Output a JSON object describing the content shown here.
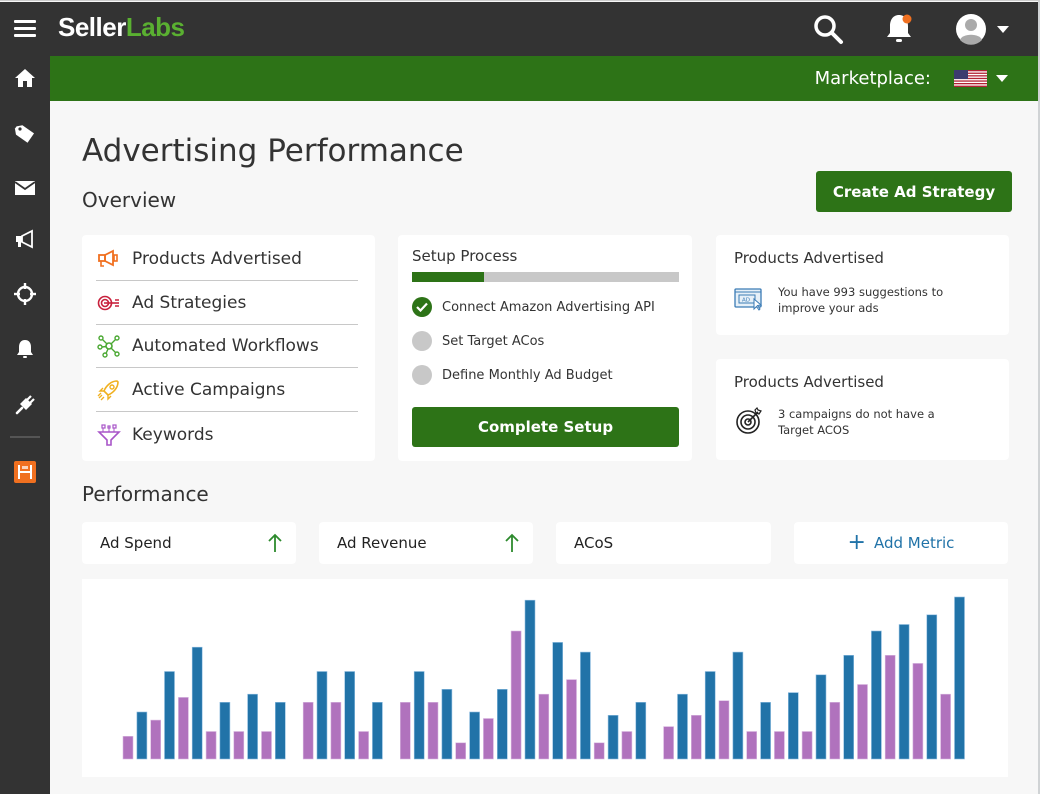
{
  "app": {
    "logo_part1": "Seller",
    "logo_part2": "Labs",
    "colors": {
      "brand_green": "#2d7317",
      "logo_green": "#5ab031",
      "dark": "#333333",
      "notification": "#f07020",
      "bar_purple": "#b072bd",
      "bar_blue": "#2173a8",
      "link_blue": "#2173a8"
    }
  },
  "topbar": {
    "menu_icon": "hamburger-icon",
    "search_icon": "search-icon",
    "notification_icon": "bell-icon",
    "avatar_icon": "user-avatar-icon",
    "has_notification": true
  },
  "marketplace": {
    "label": "Marketplace:",
    "selected": "United States",
    "flag_icon": "us-flag-icon"
  },
  "sidebar": {
    "items": [
      {
        "name": "home",
        "icon": "home-icon"
      },
      {
        "name": "products",
        "icon": "tag-icon"
      },
      {
        "name": "messages",
        "icon": "envelope-icon"
      },
      {
        "name": "advertising",
        "icon": "megaphone-icon"
      },
      {
        "name": "targeting",
        "icon": "crosshair-icon"
      },
      {
        "name": "notifications",
        "icon": "bell-icon"
      },
      {
        "name": "integrations",
        "icon": "plug-icon"
      },
      {
        "name": "app",
        "icon": "app-logo-icon"
      }
    ]
  },
  "page": {
    "title": "Advertising Performance",
    "overview_heading": "Overview",
    "create_button": "Create Ad Strategy",
    "performance_heading": "Performance"
  },
  "overview_nav": [
    {
      "label": "Products Advertised",
      "icon": "megaphone-icon",
      "color": "#f07020"
    },
    {
      "label": "Ad Strategies",
      "icon": "target-arrow-icon",
      "color": "#c8203c"
    },
    {
      "label": "Automated Workflows",
      "icon": "network-icon",
      "color": "#4aa832"
    },
    {
      "label": "Active Campaigns",
      "icon": "rocket-icon",
      "color": "#f0b020"
    },
    {
      "label": "Keywords",
      "icon": "funnel-icon",
      "color": "#a855c8"
    }
  ],
  "setup": {
    "title": "Setup Process",
    "progress_percent": 27,
    "steps": [
      {
        "label": "Connect Amazon Advertising API",
        "done": true
      },
      {
        "label": "Set Target ACos",
        "done": false
      },
      {
        "label": "Define Monthly Ad Budget",
        "done": false
      }
    ],
    "button": "Complete Setup"
  },
  "suggestions": [
    {
      "title": "Products Advertised",
      "text_line1": "You have 993 suggestions to",
      "text_line2": "improve your ads",
      "icon": "ad-click-icon"
    },
    {
      "title": "Products Advertised",
      "text_line1": "3 campaigns do not have a",
      "text_line2": "Target ACOS",
      "icon": "target-icon"
    }
  ],
  "metrics": [
    {
      "label": "Ad Spend",
      "trend": "up"
    },
    {
      "label": "Ad Revenue",
      "trend": "up"
    },
    {
      "label": "ACoS",
      "trend": null
    }
  ],
  "add_metric": {
    "label": "Add Metric"
  },
  "chart_data": {
    "type": "bar",
    "title": "",
    "xlabel": "",
    "ylabel": "",
    "ylim": [
      0,
      100
    ],
    "grid": false,
    "legend": "none",
    "series_names": [
      "purple",
      "blue"
    ],
    "groups": [
      {
        "purple": [
          14,
          24,
          38,
          17,
          17,
          17
        ],
        "blue": [
          29,
          54,
          69,
          35,
          40,
          35
        ]
      },
      {
        "purple": [
          35,
          35,
          17
        ],
        "blue": [
          54,
          54,
          35
        ]
      },
      {
        "purple": [
          35,
          35,
          10,
          25,
          79,
          40,
          49,
          10,
          17
        ],
        "blue": [
          54,
          43,
          29,
          43,
          98,
          72,
          66,
          27,
          35
        ]
      },
      {
        "purple": [
          20,
          27,
          36,
          17,
          17,
          17,
          35,
          46,
          64,
          59,
          40
        ],
        "blue": [
          40,
          54,
          66,
          35,
          41,
          52,
          64,
          79,
          83,
          89,
          100
        ]
      }
    ]
  }
}
